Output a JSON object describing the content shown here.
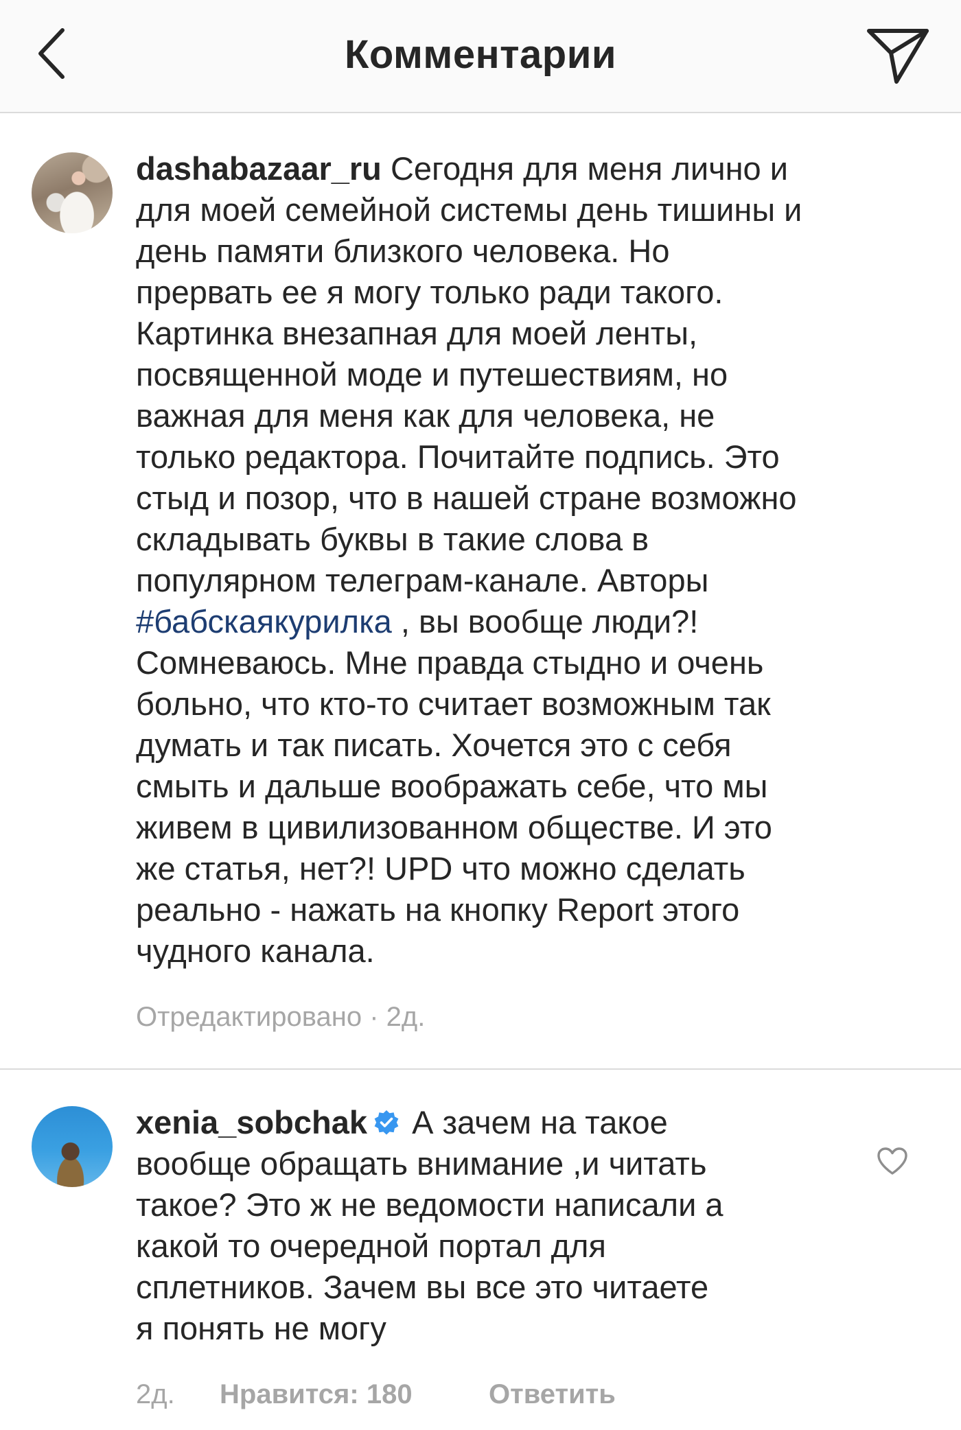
{
  "header": {
    "title": "Комментарии",
    "back_icon": "chevron-left-icon",
    "share_icon": "paper-plane-icon"
  },
  "comments": [
    {
      "username": "dashabazaar_ru",
      "avatar_icon": "avatar-photo",
      "text_first_line_rest": " Сегодня для меня лично и",
      "lines": [
        "для моей семейной системы день тишины и",
        "день памяти близкого человека. Но",
        "прервать ее я могу только ради такого.",
        "Картинка внезапная для моей ленты,",
        "посвященной моде и путешествиям, но",
        "важная для меня как для человека, не",
        "только редактора. Почитайте подпись. Это",
        "стыд и позор, что в нашей стране возможно",
        "складывать буквы в такие слова в",
        "популярном телеграм-канале. Авторы"
      ],
      "hashtag": "#бабскаякурилка",
      "hashtag_line_rest": " , вы вообще люди?!",
      "lines_after": [
        "Сомневаюсь. Мне правда стыдно и очень",
        "больно, что кто-то считает возможным так",
        "думать и так писать. Хочется это с себя",
        "смыть и дальше воображать себе, что мы",
        "живем в цивилизованном обществе. И это",
        "же статья, нет?! UPD что можно сделать",
        "реально - нажать на кнопку Report этого",
        "чудного канала."
      ],
      "meta": "Отредактировано · 2д."
    },
    {
      "username": "xenia_sobchak",
      "verified_icon": "verified-badge-icon",
      "avatar_icon": "avatar-photo",
      "text_first_line_rest": " А зачем на такое",
      "lines": [
        "вообще обращать внимание ,и читать",
        "такое? Это ж не ведомости написали а",
        "какой то очередной портал для",
        "сплетников. Зачем вы все это читаете",
        "я понять не могу"
      ],
      "time": "2д.",
      "likes": "Нравится: 180",
      "reply": "Ответить",
      "like_icon": "heart-outline-icon"
    }
  ],
  "colors": {
    "header_bg": "#fafafa",
    "text": "#262626",
    "meta": "#a6a6a6",
    "hashtag": "#1d3d72",
    "verified": "#3897f0",
    "divider": "#dbdbdb"
  }
}
